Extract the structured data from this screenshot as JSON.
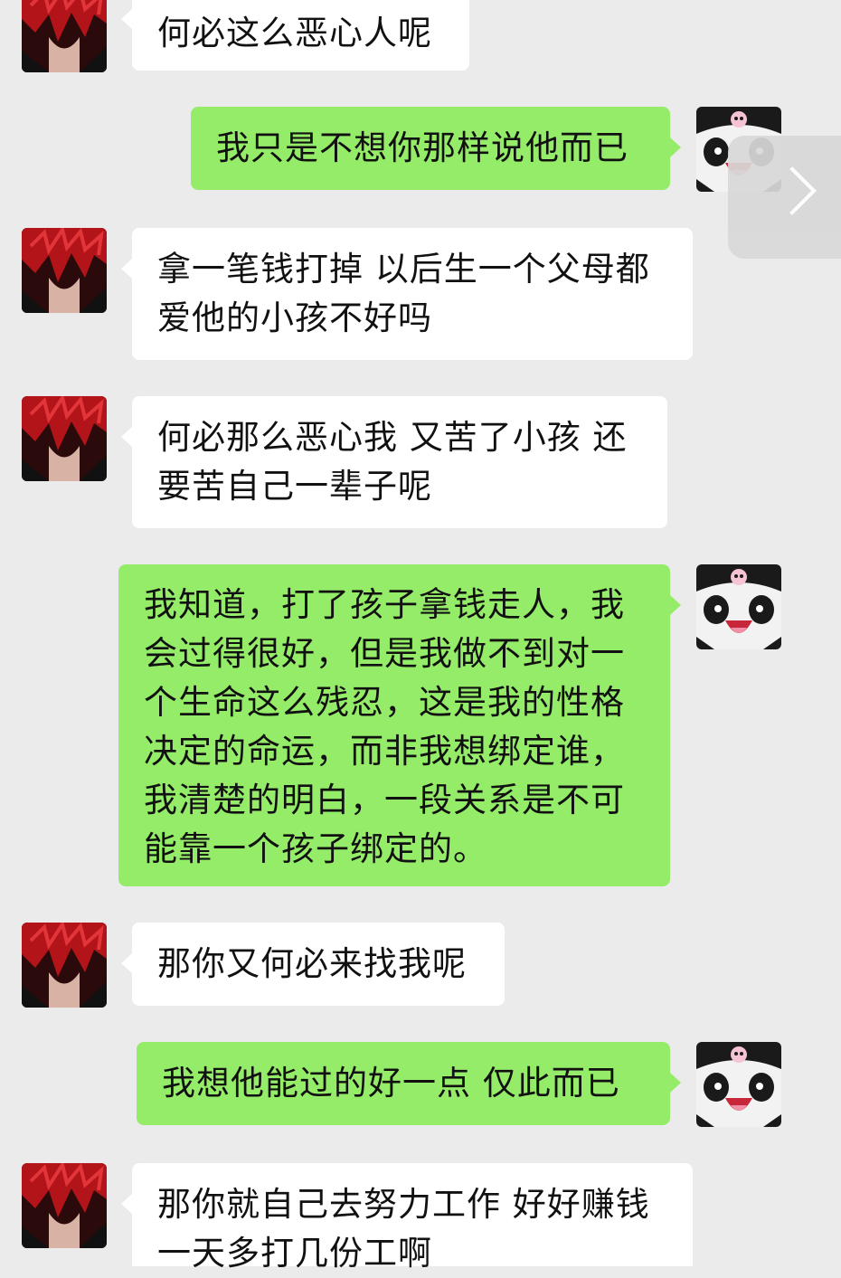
{
  "colors": {
    "background": "#ebebeb",
    "incoming_bubble": "#ffffff",
    "outgoing_bubble": "#95ec69",
    "text": "#111111"
  },
  "contacts": {
    "other": {
      "avatar_icon": "red-haired-anime-avatar-icon"
    },
    "self": {
      "avatar_icon": "panda-cartoon-avatar-icon"
    }
  },
  "messages": [
    {
      "from": "other",
      "text": "何必这么恶心人呢"
    },
    {
      "from": "self",
      "text": "我只是不想你那样说他而已"
    },
    {
      "from": "other",
      "text": "拿一笔钱打掉 以后生一个父母都爱他的小孩不好吗"
    },
    {
      "from": "other",
      "text": "何必那么恶心我 又苦了小孩 还要苦自己一辈子呢"
    },
    {
      "from": "self",
      "text": "我知道，打了孩子拿钱走人，我会过得很好，但是我做不到对一个生命这么残忍，这是我的性格决定的命运，而非我想绑定谁，我清楚的明白，一段关系是不可能靠一个孩子绑定的。"
    },
    {
      "from": "other",
      "text": "那你又何必来找我呢"
    },
    {
      "from": "self",
      "text": "我想他能过的好一点 仅此而已"
    },
    {
      "from": "other",
      "text": "那你就自己去努力工作 好好赚钱一天多打几份工啊"
    }
  ],
  "side_button": {
    "icon": "chevron-right-icon"
  }
}
